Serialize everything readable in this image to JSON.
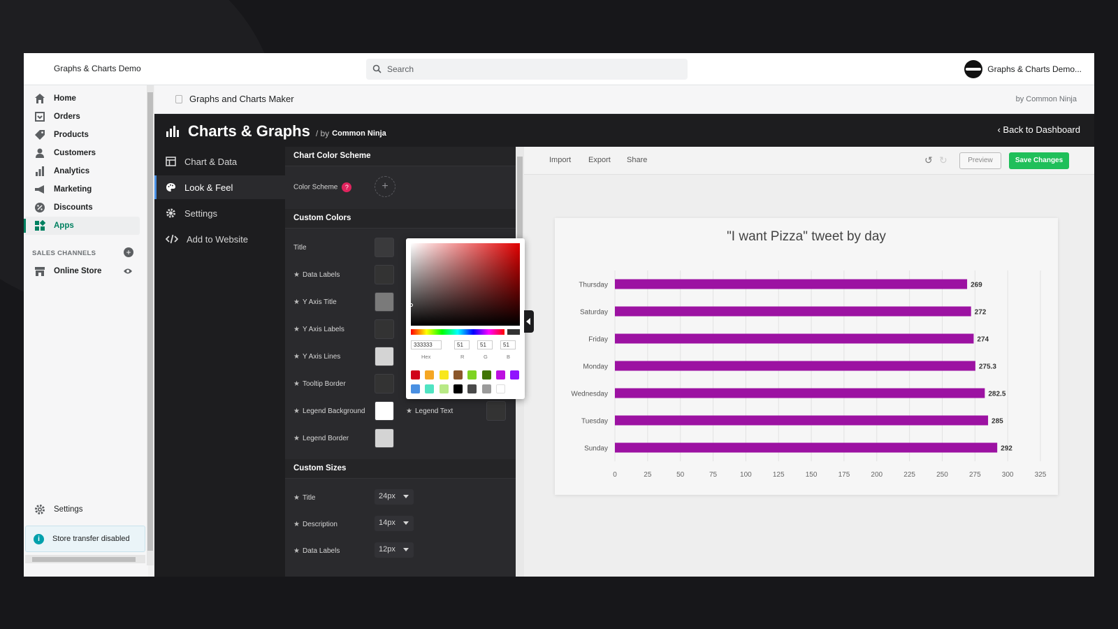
{
  "topbar": {
    "store_name": "Graphs & Charts Demo",
    "search_placeholder": "Search",
    "account_name": "Graphs & Charts Demo..."
  },
  "leftnav": {
    "items": [
      {
        "label": "Home",
        "icon": "home-icon"
      },
      {
        "label": "Orders",
        "icon": "orders-icon"
      },
      {
        "label": "Products",
        "icon": "tag-icon"
      },
      {
        "label": "Customers",
        "icon": "person-icon"
      },
      {
        "label": "Analytics",
        "icon": "bar-chart-icon"
      },
      {
        "label": "Marketing",
        "icon": "megaphone-icon"
      },
      {
        "label": "Discounts",
        "icon": "discount-icon"
      },
      {
        "label": "Apps",
        "icon": "apps-icon",
        "active": true
      }
    ],
    "sales_channels_title": "SALES CHANNELS",
    "online_store": "Online Store",
    "settings": "Settings",
    "banner": "Store transfer disabled"
  },
  "apphead": {
    "title": "Graphs and Charts Maker",
    "by": "by Common Ninja"
  },
  "editor": {
    "brand_title": "Charts & Graphs",
    "brand_by": "/  by",
    "brand_name": "Common Ninja",
    "back": "Back to Dashboard",
    "tabs": [
      "Chart & Data",
      "Look & Feel",
      "Settings",
      "Add to Website"
    ],
    "active_tab": "Look & Feel"
  },
  "panel": {
    "scheme_header": "Chart Color Scheme",
    "color_scheme_label": "Color Scheme",
    "help_mark": "?",
    "custom_colors_header": "Custom Colors",
    "colors": [
      {
        "label": "Title",
        "color": "#3a3a3c"
      },
      {
        "label": "Data Labels",
        "color": "#333333"
      },
      {
        "label": "Y Axis Title",
        "color": "#7a7a7a"
      },
      {
        "label": "Y Axis Labels",
        "color": "#333333"
      },
      {
        "label": "Y Axis Lines",
        "color": "#d4d4d4"
      },
      {
        "label": "Tooltip Border",
        "color": "#333333"
      },
      {
        "label": "Legend Background",
        "color": "#ffffff"
      },
      {
        "label": "Legend Border",
        "color": "#d4d4d4"
      }
    ],
    "legend_text_label": "Legend Text",
    "legend_text_color": "#333333",
    "custom_sizes_header": "Custom Sizes",
    "sizes": [
      {
        "label": "Title",
        "value": "24px"
      },
      {
        "label": "Description",
        "value": "14px"
      },
      {
        "label": "Data Labels",
        "value": "12px"
      }
    ]
  },
  "picker": {
    "hex": "333333",
    "r": "51",
    "g": "51",
    "b": "51",
    "labels": [
      "Hex",
      "R",
      "G",
      "B"
    ],
    "palette": [
      "#d0021b",
      "#f5a623",
      "#f8e71c",
      "#8b572a",
      "#7ed321",
      "#417505",
      "#bd10e0",
      "#9013fe",
      "#4a90e2",
      "#50e3c2",
      "#b8e986",
      "#000000",
      "#4a4a4a",
      "#9b9b9b",
      "#ffffff"
    ]
  },
  "preview": {
    "import": "Import",
    "export": "Export",
    "share": "Share",
    "preview_btn": "Preview",
    "save_btn": "Save Changes"
  },
  "chart_data": {
    "type": "bar",
    "orientation": "horizontal",
    "title": "\"I want Pizza\" tweet by day",
    "categories": [
      "Thursday",
      "Saturday",
      "Friday",
      "Monday",
      "Wednesday",
      "Tuesday",
      "Sunday"
    ],
    "values": [
      269,
      272,
      274,
      275.3,
      282.5,
      285,
      292
    ],
    "data_labels": [
      "269",
      "272",
      "274",
      "275.3",
      "282.5",
      "285",
      "292"
    ],
    "xlim": [
      0,
      325
    ],
    "xticks": [
      0,
      25,
      50,
      75,
      100,
      125,
      150,
      175,
      200,
      225,
      250,
      275,
      300,
      325
    ],
    "bar_color": "#9c12a2",
    "grid": true
  }
}
